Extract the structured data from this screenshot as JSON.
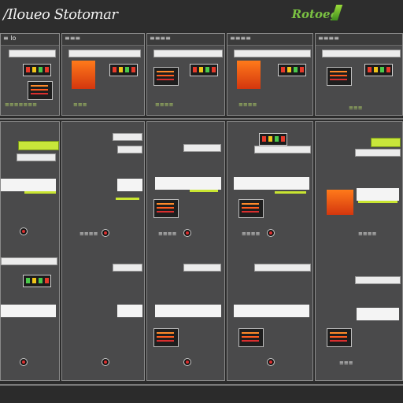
{
  "header": {
    "title": "/Iloueo Stotomar",
    "brand": "Rotoeg"
  },
  "panels_top": [
    {
      "label": "≡ lo",
      "status": "≡≡≡≡≡≡≡"
    },
    {
      "label": "≡≡≡",
      "status": "≡≡≡"
    },
    {
      "label": "≡≡≡≡",
      "status": "≡≡≡≡"
    },
    {
      "label": "≡≡≡≡",
      "status": "≡≡≡≡"
    },
    {
      "label": "≡≡≡≡",
      "status": "≡≡≡"
    }
  ],
  "panels_bottom_labels": [
    "≡≡≡≡",
    "≡≡≡≡",
    "≡≡≡≡",
    "≡≡≡≡",
    "≡≡≡"
  ],
  "colors": {
    "accent_green": "#c8e63a",
    "accent_orange": "#ff7a1a",
    "panel_bg": "#4a4a4b"
  }
}
